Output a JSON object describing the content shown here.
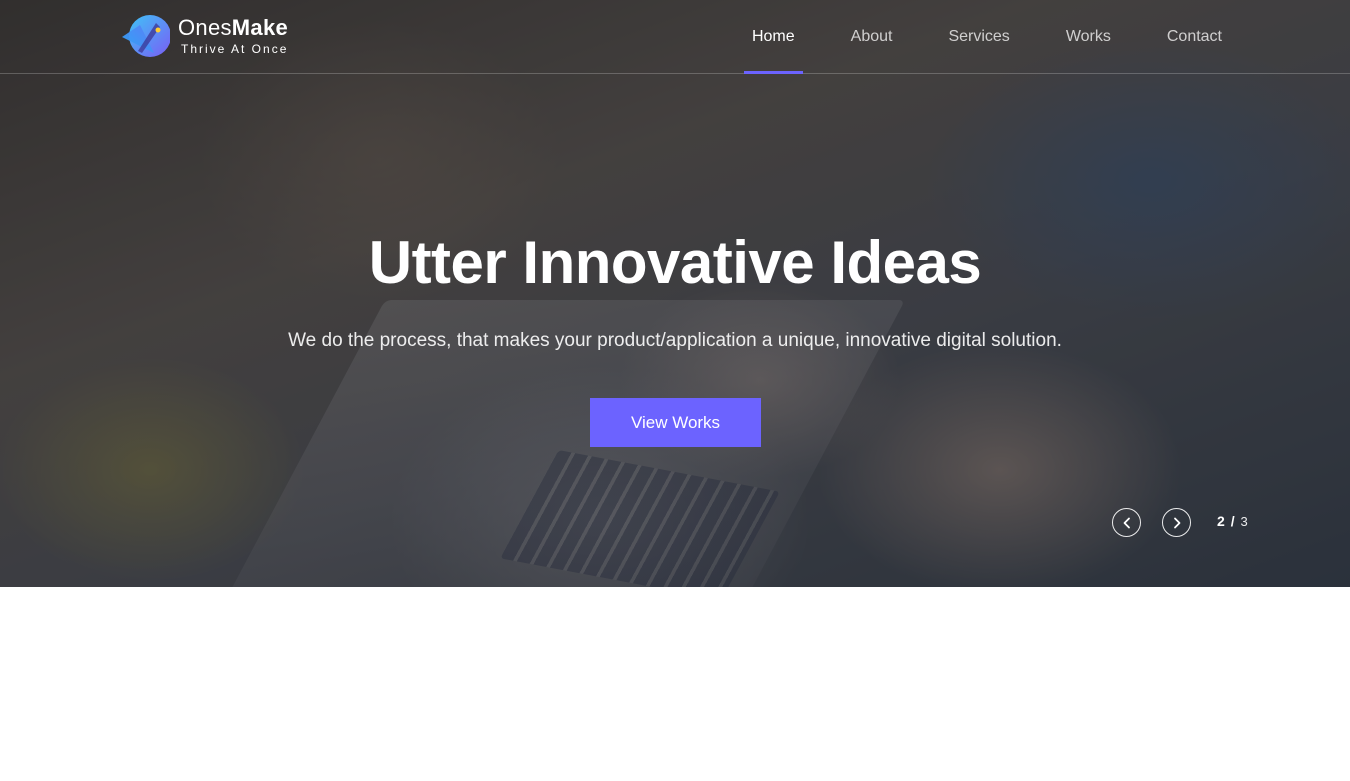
{
  "brand": {
    "name_light": "Ones",
    "name_bold": "Make",
    "tagline": "Thrive At Once"
  },
  "nav": {
    "items": [
      {
        "label": "Home",
        "active": true
      },
      {
        "label": "About",
        "active": false
      },
      {
        "label": "Services",
        "active": false
      },
      {
        "label": "Works",
        "active": false
      },
      {
        "label": "Contact",
        "active": false
      }
    ]
  },
  "hero": {
    "title": "Utter Innovative Ideas",
    "subtitle": "We do the process, that makes your product/application a unique, innovative digital solution.",
    "cta_label": "View Works"
  },
  "slider": {
    "current": "2",
    "separator": "/",
    "total": "3",
    "prev_icon": "chevron-left-icon",
    "next_icon": "chevron-right-icon"
  },
  "colors": {
    "accent": "#6c63ff",
    "logo_blue": "#2aa7f5",
    "logo_purple": "#7a5cf5"
  }
}
